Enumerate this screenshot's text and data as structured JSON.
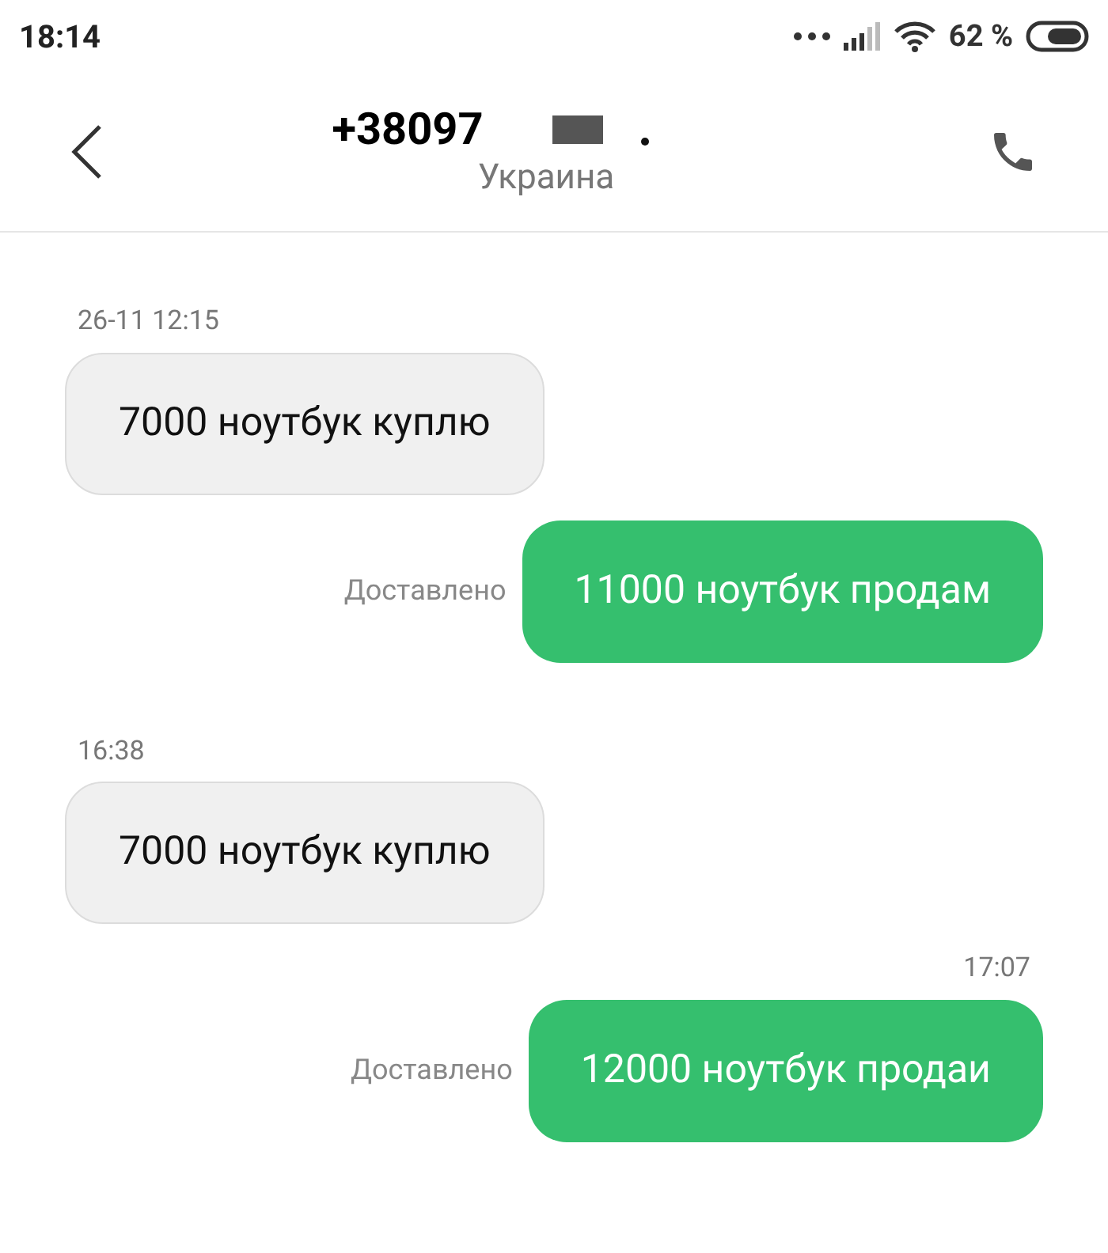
{
  "status_bar": {
    "time": "18:14",
    "battery": "62 %"
  },
  "header": {
    "title": "+38097",
    "subtitle": "Украина"
  },
  "messages": [
    {
      "kind": "received",
      "time": "26-11 12:15",
      "text": "7000 ноутбук куплю"
    },
    {
      "kind": "sent",
      "status": "Доставлено",
      "text": "11000 ноутбук продам"
    },
    {
      "kind": "received",
      "time": "16:38",
      "text": "7000 ноутбук куплю"
    },
    {
      "kind": "sent",
      "time": "17:07",
      "status": "Доставлено",
      "text": "12000 ноутбук продаи"
    }
  ]
}
